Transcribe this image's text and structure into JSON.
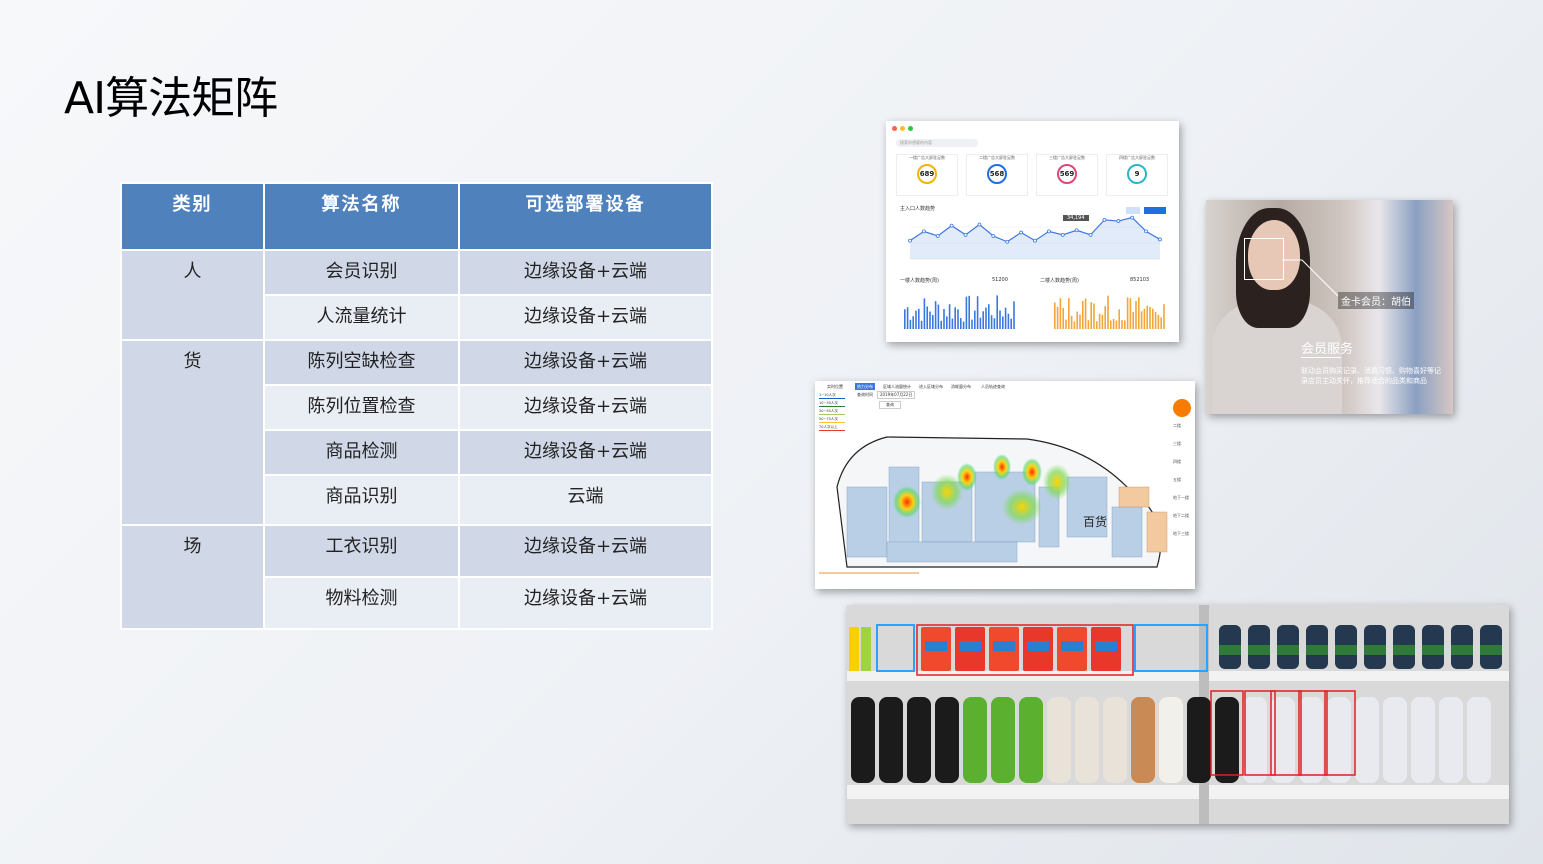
{
  "title": "AI算法矩阵",
  "table": {
    "headers": [
      "类别",
      "算法名称",
      "可选部署设备"
    ],
    "groups": [
      {
        "category": "人",
        "rows": [
          {
            "name": "会员识别",
            "device": "边缘设备+云端"
          },
          {
            "name": "人流量统计",
            "device": "边缘设备+云端"
          }
        ]
      },
      {
        "category": "货",
        "rows": [
          {
            "name": "陈列空缺检查",
            "device": "边缘设备+云端"
          },
          {
            "name": "陈列位置检查",
            "device": "边缘设备+云端"
          },
          {
            "name": "商品检测",
            "device": "边缘设备+云端"
          },
          {
            "name": "商品识别",
            "device": "云端"
          }
        ]
      },
      {
        "category": "场",
        "rows": [
          {
            "name": "工衣识别",
            "device": "边缘设备+云端"
          },
          {
            "name": "物料检测",
            "device": "边缘设备+云端"
          }
        ]
      }
    ]
  },
  "dashboard": {
    "search_placeholder": "搜索你想要的内容",
    "kpis": [
      {
        "label": "一楼广告大屏驻足数",
        "value": "689",
        "color": "#f4b400"
      },
      {
        "label": "二楼广告大屏驻足数",
        "value": "568",
        "color": "#1e6fe0"
      },
      {
        "label": "三楼广告大屏驻足数",
        "value": "569",
        "color": "#e0457b"
      },
      {
        "label": "四楼广告大屏驻足数",
        "value": "9",
        "color": "#2bb6c8"
      }
    ],
    "trend_title": "主入口人数趋势",
    "trend_tooltip": "34,194",
    "trend_points": [
      1.6,
      2.4,
      2.0,
      2.9,
      2.1,
      3.0,
      2.0,
      1.5,
      2.3,
      1.6,
      2.4,
      2.1,
      2.5,
      2.1,
      3.4,
      3.3,
      3.6,
      2.4,
      1.7
    ],
    "floor1_title": "一楼人数趋势(周)",
    "floor1_total": "51200",
    "floor2_title": "二楼人数趋势(周)",
    "floor2_total": "852103"
  },
  "member": {
    "tag": "金卡会员：胡伯",
    "title": "会员服务",
    "desc": "联动会员购买记录、消费习惯、购物喜好等记录店员主动关怀，推荐适合的品类和商品"
  },
  "heatmap": {
    "tabs": [
      "实时位置",
      "热力分布",
      "区域人流量统计",
      "进入区域分布",
      "消耗量分布",
      "人员轨迹查询"
    ],
    "legend": [
      "1~10人次",
      "10~30人次",
      "30~50人次",
      "50~70人次",
      "70人次以上"
    ],
    "legend_colors": [
      "#1565c0",
      "#2e7d32",
      "#9ccc65",
      "#fbc02d",
      "#e53935"
    ],
    "date_label": "查询时间",
    "date_value": "2019年07月22日",
    "query_button": "查询",
    "floors": [
      "二楼",
      "三楼",
      "四楼",
      "五楼",
      "地下一楼",
      "地下二楼",
      "地下三楼"
    ],
    "area_label": "百货"
  }
}
